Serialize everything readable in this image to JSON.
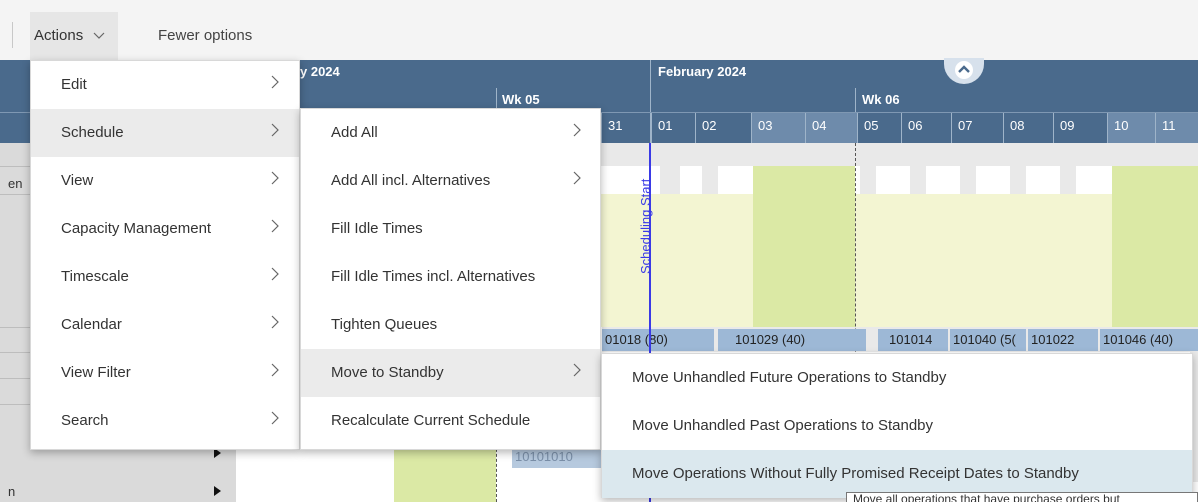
{
  "toolbar": {
    "actions_label": "Actions",
    "fewer_options_label": "Fewer options"
  },
  "timeline": {
    "month_left": "y 2024",
    "month_right": "February 2024",
    "week_left": "Wk 05",
    "week_right": "Wk 06",
    "days": [
      "31",
      "01",
      "02",
      "03",
      "04",
      "05",
      "06",
      "07",
      "08",
      "09",
      "10",
      "11"
    ]
  },
  "gantt": {
    "scheduling_start_label": "Scheduling Start",
    "left_label_top": "en",
    "left_label_bottom": "n",
    "bars": [
      "01018 (80)",
      "101029 (40)",
      "101014",
      "101040 (5(",
      "101022",
      "101046 (40)",
      "10101010"
    ],
    "edge_value": ")"
  },
  "menus": {
    "actions": {
      "items": [
        {
          "label": "Edit",
          "submenu": true
        },
        {
          "label": "Schedule",
          "submenu": true
        },
        {
          "label": "View",
          "submenu": true
        },
        {
          "label": "Capacity Management",
          "submenu": true
        },
        {
          "label": "Timescale",
          "submenu": true
        },
        {
          "label": "Calendar",
          "submenu": true
        },
        {
          "label": "View Filter",
          "submenu": true
        },
        {
          "label": "Search",
          "submenu": true
        }
      ],
      "selected": "Schedule"
    },
    "schedule": {
      "items": [
        {
          "label": "Add All",
          "submenu": true
        },
        {
          "label": "Add All incl. Alternatives",
          "submenu": true
        },
        {
          "label": "Fill Idle Times",
          "submenu": false
        },
        {
          "label": "Fill Idle Times incl. Alternatives",
          "submenu": false
        },
        {
          "label": "Tighten Queues",
          "submenu": false
        },
        {
          "label": "Move to Standby",
          "submenu": true
        },
        {
          "label": "Recalculate Current Schedule",
          "submenu": false
        }
      ],
      "selected": "Move to Standby"
    },
    "standby": {
      "items": [
        {
          "label": "Move Unhandled Future Operations to Standby"
        },
        {
          "label": "Move Unhandled Past Operations to Standby"
        },
        {
          "label": "Move Operations Without Fully Promised Receipt Dates to Standby"
        }
      ],
      "hovered": "Move Operations Without Fully Promised Receipt Dates to Standby"
    }
  },
  "tooltip": {
    "text": "Move all operations that have purchase orders but"
  },
  "icons": {
    "submenu_arrow": "chevron-right-icon",
    "dropdown": "chevron-down-icon",
    "collapse": "chevron-up-icon",
    "row_expander": "triangle-right-icon"
  },
  "colors": {
    "header": "#4a6a8c",
    "scheduling_start": "#3a3ae6",
    "weekend": "#dbe9a5",
    "bar": "#9db8d6",
    "menu_selected": "#ebebeb",
    "menu_hover": "#dbe8ee"
  }
}
